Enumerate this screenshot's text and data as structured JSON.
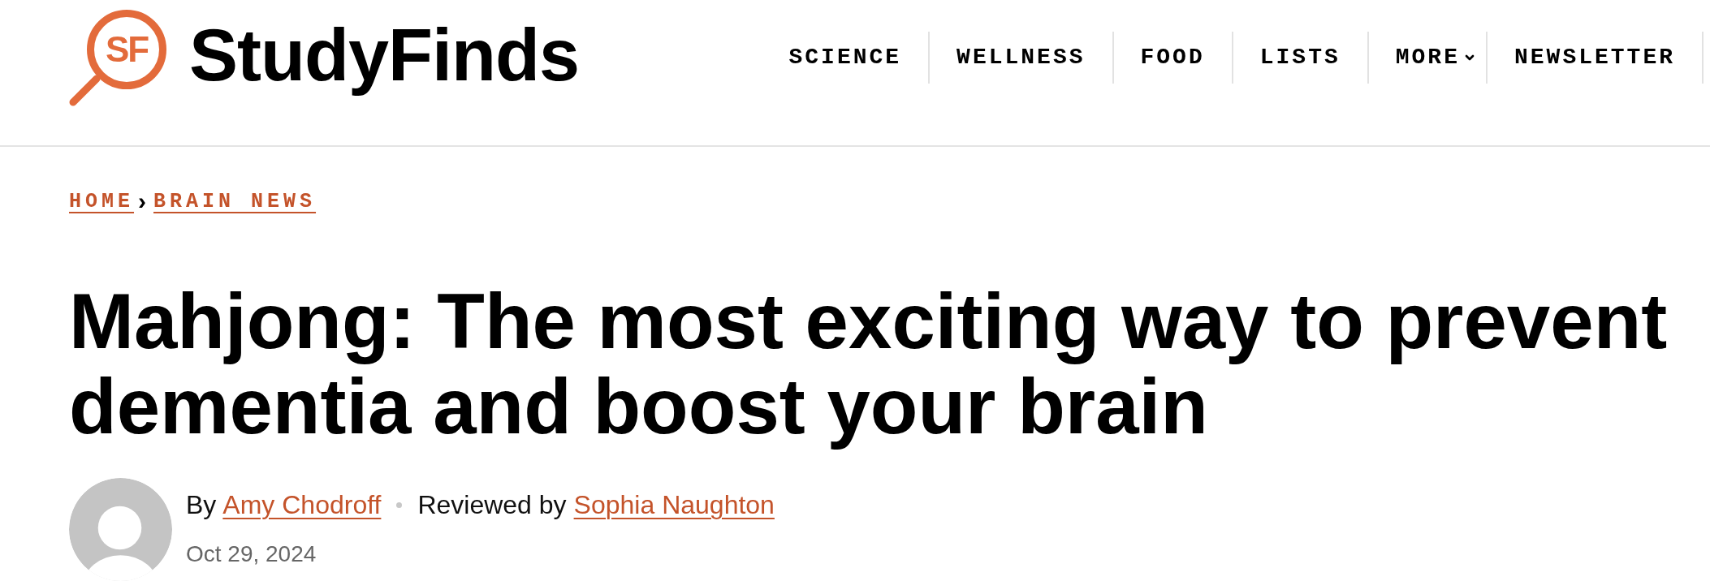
{
  "header": {
    "logo": {
      "monogram": "SF",
      "wordmark": "StudyFinds"
    },
    "nav": [
      {
        "label": "SCIENCE",
        "kind": "link"
      },
      {
        "label": "WELLNESS",
        "kind": "link"
      },
      {
        "label": "FOOD",
        "kind": "link"
      },
      {
        "label": "LISTS",
        "kind": "link"
      },
      {
        "label": "MORE",
        "kind": "dropdown"
      },
      {
        "label": "NEWSLETTER",
        "kind": "link"
      }
    ]
  },
  "breadcrumb": {
    "items": [
      "HOME",
      "BRAIN NEWS"
    ],
    "separator": "›"
  },
  "article": {
    "title": "Mahjong: The most exciting way to prevent dementia and boost your brain",
    "byline": {
      "prefix": "By",
      "author": "Amy Chodroff",
      "reviewer_prefix": "Reviewed by",
      "reviewer": "Sophia Naughton",
      "date": "Oct 29, 2024"
    }
  }
}
